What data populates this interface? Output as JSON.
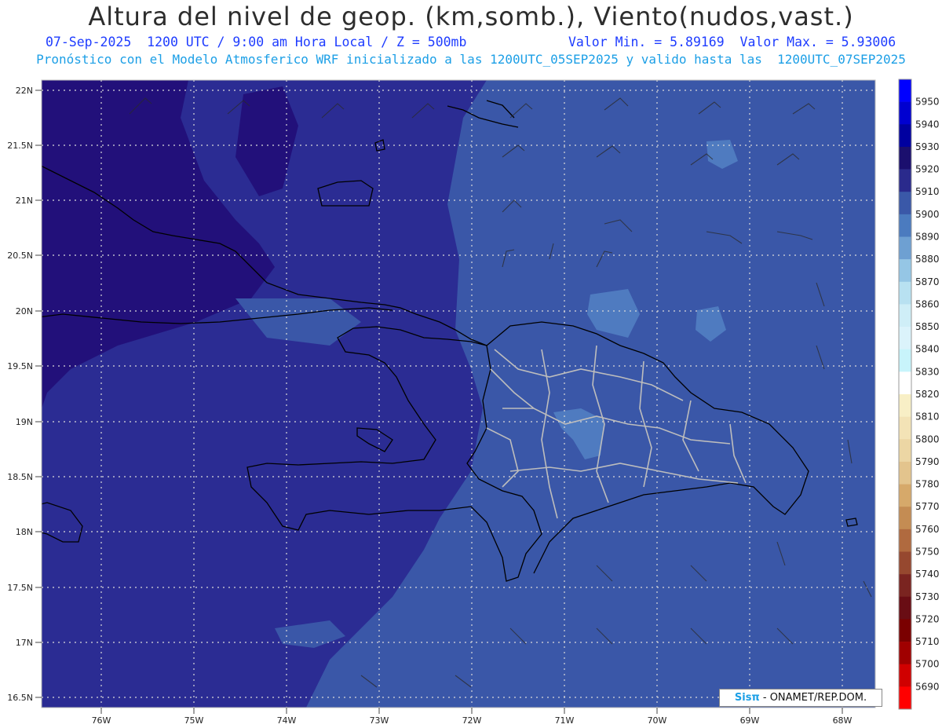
{
  "header": {
    "title": "Altura del nivel de geop. (km,somb.), Viento(nudos,vast.)",
    "line1_left": "07-Sep-2025  1200 UTC / 9:00 am Hora Local / Z = 500mb",
    "line1_right": "Valor Min. = 5.89169  Valor Max. = 5.93006",
    "line2": "Pronóstico con el Modelo Atmosferico WRF inicializado a las 1200UTC_05SEP2025 y valido hasta las  1200UTC_07SEP2025"
  },
  "map": {
    "lat_labels": [
      "22N",
      "21.5N",
      "21N",
      "20.5N",
      "20N",
      "19.5N",
      "19N",
      "18.5N",
      "18N",
      "17.5N",
      "17N",
      "16.5N"
    ],
    "lon_labels": [
      "76W",
      "75W",
      "74W",
      "73W",
      "72W",
      "71W",
      "70W",
      "69W",
      "68W"
    ],
    "colors": {
      "dark_5920": "#22107a",
      "mid_5910": "#2b2c93",
      "light_5900": "#3a57a8",
      "pale_5890": "#4f7bc0",
      "coast": "#000000",
      "borders": "#b8b8b8",
      "grid": "#d8d8d8"
    }
  },
  "colorbar": {
    "labels": [
      "5950",
      "5940",
      "5930",
      "5920",
      "5910",
      "5900",
      "5890",
      "5880",
      "5870",
      "5860",
      "5850",
      "5840",
      "5830",
      "5820",
      "5810",
      "5800",
      "5790",
      "5780",
      "5770",
      "5760",
      "5750",
      "5740",
      "5730",
      "5720",
      "5710",
      "5700",
      "5690"
    ],
    "colors": [
      "#0000ff",
      "#0000d0",
      "#0000a0",
      "#1b0f6e",
      "#2a2a8c",
      "#3a58a8",
      "#4b7bbf",
      "#6ea0d2",
      "#95c6e5",
      "#b8e1f1",
      "#cfeef7",
      "#dbf3fb",
      "#c8f4fb",
      "#ffffff",
      "#f8efc6",
      "#f3e3b6",
      "#ecd6a4",
      "#e3c48d",
      "#d6a96a",
      "#c48c53",
      "#b06a3f",
      "#96482f",
      "#7a2420",
      "#690d14",
      "#7a0000",
      "#a00000",
      "#d00000",
      "#ff0000"
    ]
  },
  "credit": {
    "brand": "Sisπ",
    "org": "- ONAMET/REP.DOM."
  }
}
